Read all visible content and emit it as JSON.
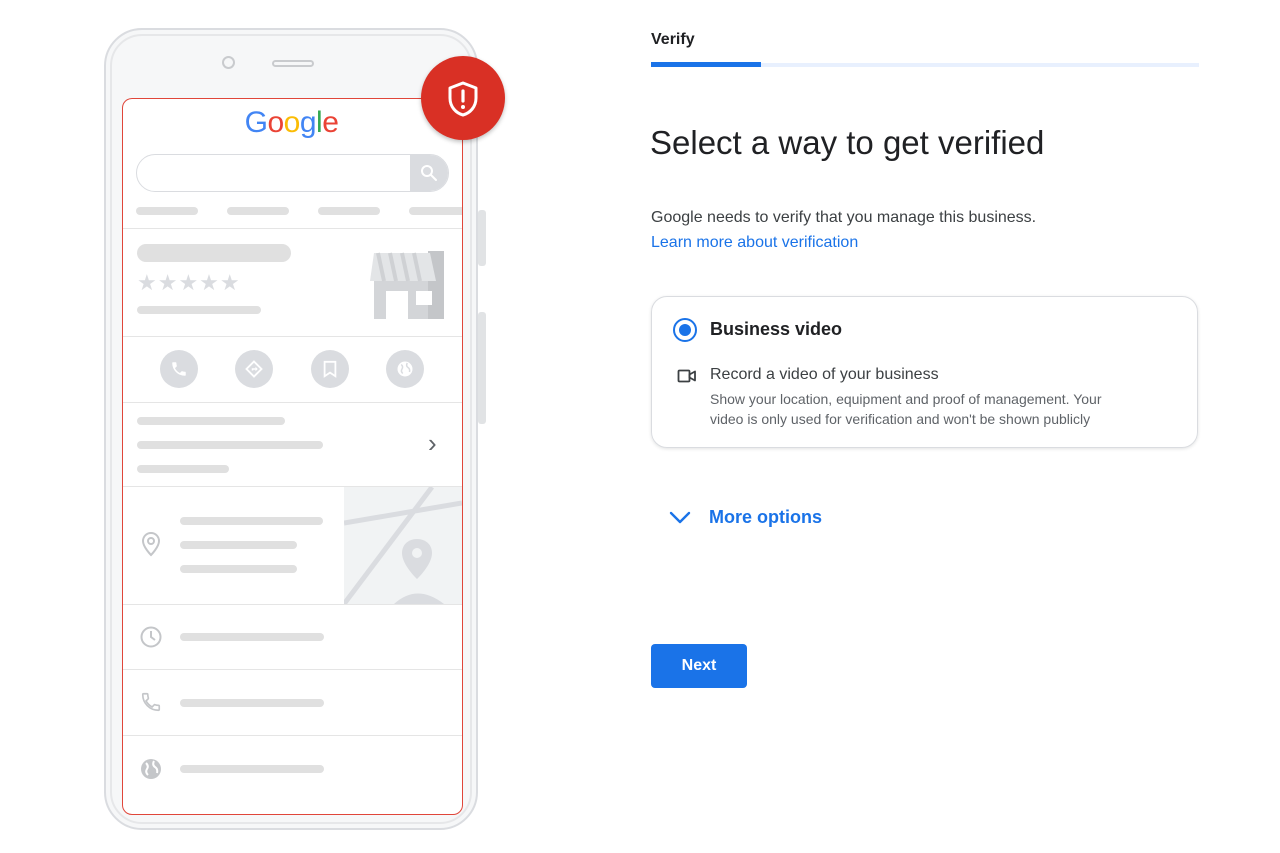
{
  "illustration": {
    "logo_letters": [
      {
        "char": "G",
        "color": "#4285f4"
      },
      {
        "char": "o",
        "color": "#ea4335"
      },
      {
        "char": "o",
        "color": "#fbbc05"
      },
      {
        "char": "g",
        "color": "#4285f4"
      },
      {
        "char": "l",
        "color": "#34a853"
      },
      {
        "char": "e",
        "color": "#ea4335"
      }
    ],
    "rating_stars": "★★★★★",
    "chevron": "›",
    "icons": [
      "shield-alert-icon",
      "search-icon",
      "storefront-icon",
      "phone-icon",
      "directions-icon",
      "bookmark-icon",
      "globe-icon",
      "location-pin-icon",
      "clock-icon",
      "map-icon"
    ]
  },
  "header": {
    "step_label": "Verify",
    "progress_percent": 20
  },
  "main": {
    "title": "Select a way to get verified",
    "description": "Google needs to verify that you manage this business.",
    "learn_more_link": "Learn more about verification"
  },
  "option": {
    "title": "Business video",
    "selected": true,
    "subtitle": "Record a video of your business",
    "help_line1": "Show your location, equipment and proof of management. Your",
    "help_line2": "video is only used for verification and won't be shown publicly",
    "icon": "videocam-icon"
  },
  "more_options": {
    "label": "More options",
    "icon": "chevron-down-icon"
  },
  "actions": {
    "next_label": "Next"
  },
  "colors": {
    "accent": "#1a73e8",
    "badge_red": "#d93025",
    "screen_border": "#e0463a"
  }
}
